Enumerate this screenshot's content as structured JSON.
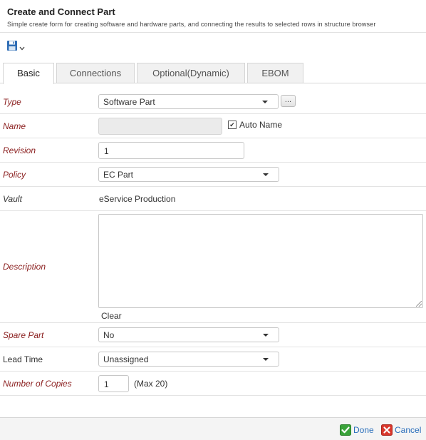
{
  "header": {
    "title": "Create and Connect Part",
    "subtitle": "Simple create form for creating software and hardware parts, and connecting the results to selected rows in structure browser"
  },
  "toolbar": {
    "save_icon": "save-icon",
    "dropdown_icon": "chevron-down-icon"
  },
  "tabs": [
    {
      "label": "Basic",
      "active": true
    },
    {
      "label": "Connections",
      "active": false
    },
    {
      "label": "Optional(Dynamic)",
      "active": false
    },
    {
      "label": "EBOM",
      "active": false
    }
  ],
  "form": {
    "type": {
      "label": "Type",
      "value": "Software Part",
      "chooser_label": "..."
    },
    "name": {
      "label": "Name",
      "value": "",
      "auto_name_label": "Auto Name",
      "auto_name_checked": true
    },
    "revision": {
      "label": "Revision",
      "value": "1"
    },
    "policy": {
      "label": "Policy",
      "value": "EC Part"
    },
    "vault": {
      "label": "Vault",
      "value": "eService Production"
    },
    "description": {
      "label": "Description",
      "value": "",
      "clear_label": "Clear"
    },
    "spare_part": {
      "label": "Spare Part",
      "value": "No"
    },
    "lead_time": {
      "label": "Lead Time",
      "value": "Unassigned"
    },
    "number_of_copies": {
      "label": "Number of Copies",
      "value": "1",
      "note": "(Max 20)"
    }
  },
  "footer": {
    "done_label": "Done",
    "cancel_label": "Cancel"
  },
  "colors": {
    "required_label": "#8b1f1f",
    "link": "#2a6ebb",
    "done_icon": "#3aa33a",
    "cancel_icon": "#d9362b"
  }
}
